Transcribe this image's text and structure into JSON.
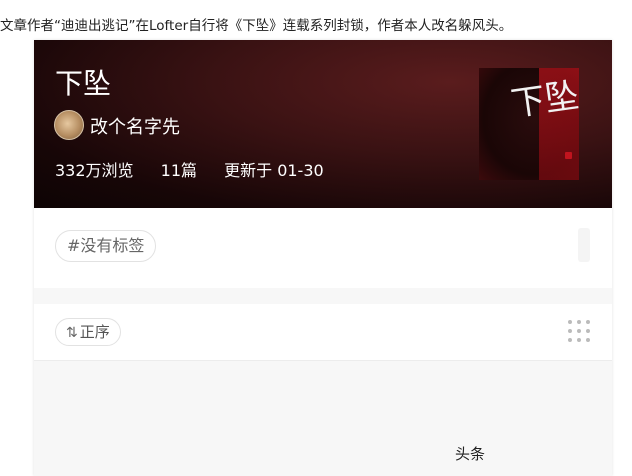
{
  "caption": "文章作者“迪迪出逃记”在Lofter自行将《下坠》连载系列封锁，作者本人改名躲风头。",
  "header": {
    "title": "下坠",
    "author": "改个名字先",
    "views": "332万浏览",
    "count": "11篇",
    "updated": "更新于 01-30",
    "cover_text": "下坠"
  },
  "tags": {
    "empty_label": "#没有标签"
  },
  "sort": {
    "icon_label": "⇅",
    "label": "正序"
  },
  "watermark": "头条"
}
